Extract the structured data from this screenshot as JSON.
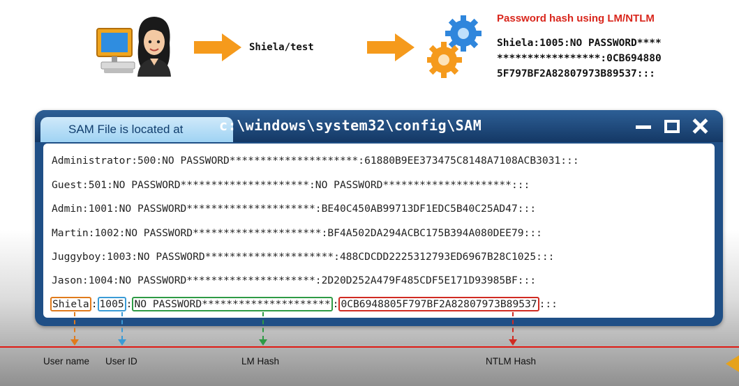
{
  "credentials_text": "Shiela/test",
  "hash_box": {
    "title": "Password hash using LM/NTLM",
    "lines": [
      "Shiela:1005:NO PASSWORD****",
      "*****************:0CB694880",
      "5F797BF2A82807973B89537:::"
    ]
  },
  "window": {
    "tab_label": "SAM File is located at",
    "path": "c:\\windows\\system32\\config\\SAM"
  },
  "sam_rows": [
    "Administrator:500:NO PASSWORD*********************:61880B9EE373475C8148A7108ACB3031:::",
    "Guest:501:NO PASSWORD*********************:NO PASSWORD*********************:::",
    "Admin:1001:NO PASSWORD*********************:BE40C450AB99713DF1EDC5B40C25AD47:::",
    "Martin:1002:NO PASSWORD*********************:BF4A502DA294ACBC175B394A080DEE79:::",
    "Juggyboy:1003:NO PASSWORD*********************:488CDCDD2225312793ED6967B28C1025:::",
    "Jason:1004:NO PASSWORD*********************:2D20D252A479F485CDF5E171D93985BF:::"
  ],
  "highlighted_row": {
    "user": "Shiela",
    "sep1": ":",
    "id": "1005",
    "sep2": ":",
    "lm": "NO PASSWORD*********************",
    "sep3": ":",
    "ntlm": "0CB6948805F797BF2A82807973B89537",
    "tail": ":::"
  },
  "labels": {
    "user_name": "User name",
    "user_id": "User ID",
    "lm_hash": "LM Hash",
    "ntlm_hash": "NTLM Hash"
  },
  "colors": {
    "user": "#e07b1c",
    "id": "#3a9bd6",
    "lm": "#2e9a45",
    "ntlm": "#d02b22",
    "title_red": "#d9261c",
    "arrow_orange": "#f59a1c"
  }
}
